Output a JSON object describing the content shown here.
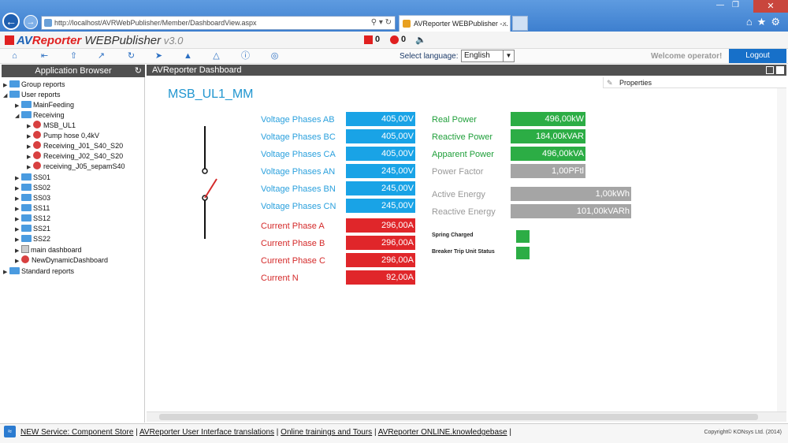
{
  "browser": {
    "url": "http://localhost/AVRWebPublisher/Member/DashboardView.aspx",
    "tab_title": "AVReporter WEBPublisher -...",
    "tab_close": "×"
  },
  "app": {
    "logo_part1": "AV",
    "logo_part2": "Reporter",
    "logo_product": " WEBPublisher",
    "logo_version": " v3.0",
    "alarm_count_1": "0",
    "alarm_count_2": "0"
  },
  "toolbar": {
    "select_language_label": "Select language:",
    "language_value": "English",
    "welcome_text": "Welcome operator!",
    "logout_label": "Logout"
  },
  "left_panel": {
    "title": "Application Browser",
    "tree": [
      {
        "label": "Group reports",
        "type": "folder",
        "depth": 0
      },
      {
        "label": "User reports",
        "type": "folder",
        "depth": 0
      },
      {
        "label": "MainFeeding",
        "type": "folder",
        "depth": 1
      },
      {
        "label": "Receiving",
        "type": "folder",
        "depth": 1
      },
      {
        "label": "MSB_UL1",
        "type": "report",
        "depth": 2
      },
      {
        "label": "Pump hose 0,4kV",
        "type": "report",
        "depth": 2
      },
      {
        "label": "Receiving_J01_S40_S20",
        "type": "report",
        "depth": 2
      },
      {
        "label": "Receiving_J02_S40_S20",
        "type": "report",
        "depth": 2
      },
      {
        "label": "receiving_J05_sepamS40",
        "type": "report",
        "depth": 2
      },
      {
        "label": "SS01",
        "type": "folder",
        "depth": 1
      },
      {
        "label": "SS02",
        "type": "folder",
        "depth": 1
      },
      {
        "label": "SS03",
        "type": "folder",
        "depth": 1
      },
      {
        "label": "SS11",
        "type": "folder",
        "depth": 1
      },
      {
        "label": "SS12",
        "type": "folder",
        "depth": 1
      },
      {
        "label": "SS21",
        "type": "folder",
        "depth": 1
      },
      {
        "label": "SS22",
        "type": "folder",
        "depth": 1
      },
      {
        "label": "main dashboard",
        "type": "dashboard",
        "depth": 1
      },
      {
        "label": "NewDynamicDashboard",
        "type": "report",
        "depth": 1
      },
      {
        "label": "Standard reports",
        "type": "folder",
        "depth": 0
      }
    ]
  },
  "main": {
    "title": "AVReporter Dashboard",
    "properties_label": "Properties",
    "dashboard_title": "MSB_UL1_MM",
    "left_measurements": [
      {
        "label": "Voltage Phases AB",
        "value": "405,00",
        "unit": "V",
        "kind": "blue"
      },
      {
        "label": "Voltage Phases BC",
        "value": "405,00",
        "unit": "V",
        "kind": "blue"
      },
      {
        "label": "Voltage Phases CA",
        "value": "405,00",
        "unit": "V",
        "kind": "blue"
      },
      {
        "label": "Voltage Phases AN",
        "value": "245,00",
        "unit": "V",
        "kind": "blue"
      },
      {
        "label": "Voltage Phases BN",
        "value": "245,00",
        "unit": "V",
        "kind": "blue"
      },
      {
        "label": "Voltage Phases CN",
        "value": "245,00",
        "unit": "V",
        "kind": "blue"
      },
      {
        "label": "Current Phase A",
        "value": "296,00",
        "unit": "A",
        "kind": "red"
      },
      {
        "label": "Current Phase B",
        "value": "296,00",
        "unit": "A",
        "kind": "red"
      },
      {
        "label": "Current Phase C",
        "value": "296,00",
        "unit": "A",
        "kind": "red"
      },
      {
        "label": "Current N",
        "value": "92,00",
        "unit": "A",
        "kind": "red"
      }
    ],
    "right_measurements": [
      {
        "label": "Real Power",
        "value": "496,00",
        "unit": "kW",
        "kind": "green"
      },
      {
        "label": "Reactive Power",
        "value": "184,00",
        "unit": "kVAR",
        "kind": "green"
      },
      {
        "label": "Apparent Power",
        "value": "496,00",
        "unit": "kVA",
        "kind": "green"
      },
      {
        "label": "Power Factor",
        "value": "1,00",
        "unit": "PFtl",
        "kind": "grey"
      },
      {
        "label": "Active Energy",
        "value": "1,00",
        "unit": "kWh",
        "kind": "grey"
      },
      {
        "label": "Reactive Energy",
        "value": "101,00",
        "unit": "kVARh",
        "kind": "grey"
      }
    ],
    "status_indicators": [
      {
        "label": "Spring Charged",
        "color": "#2cad45"
      },
      {
        "label": "Breaker Trip Unit Status",
        "color": "#2cad45"
      }
    ]
  },
  "footer": {
    "link1": "NEW Service: Component Store",
    "link2": "AVReporter User Interface translations",
    "link3": "Online trainings and Tours",
    "link4": "AVReporter ONLINE.knowledgebase",
    "separator": " | ",
    "copyright": "Copyright© KONsys Ltd. (2014)"
  }
}
